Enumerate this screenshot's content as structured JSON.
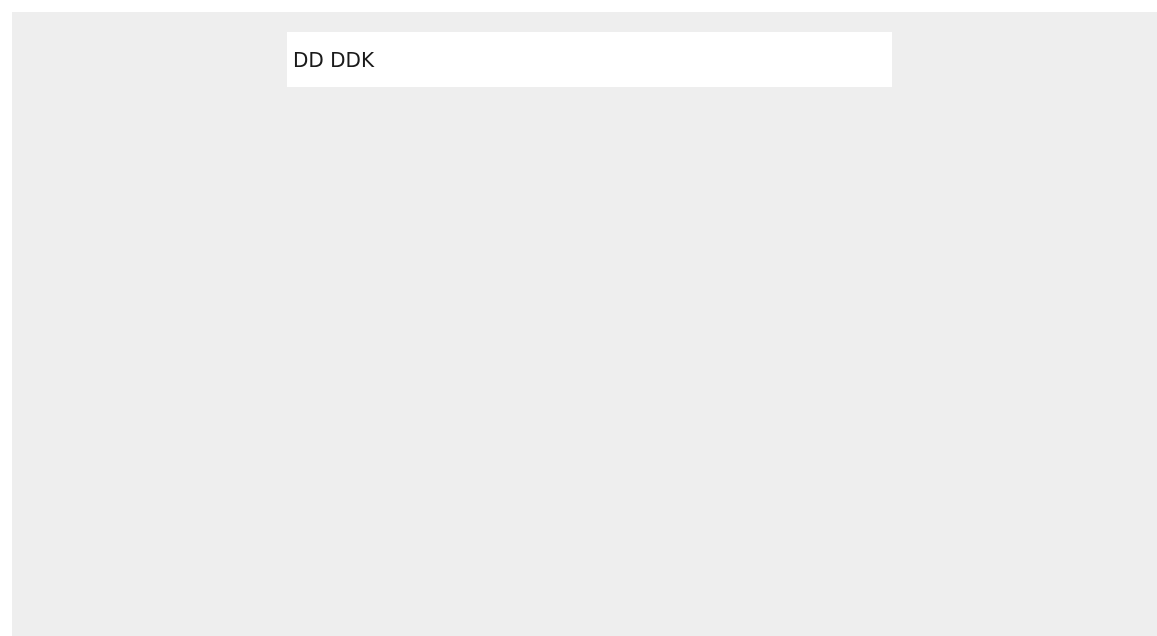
{
  "window": {
    "background_color": "#eeeeee"
  },
  "text_field": {
    "value": "DD DDK"
  }
}
